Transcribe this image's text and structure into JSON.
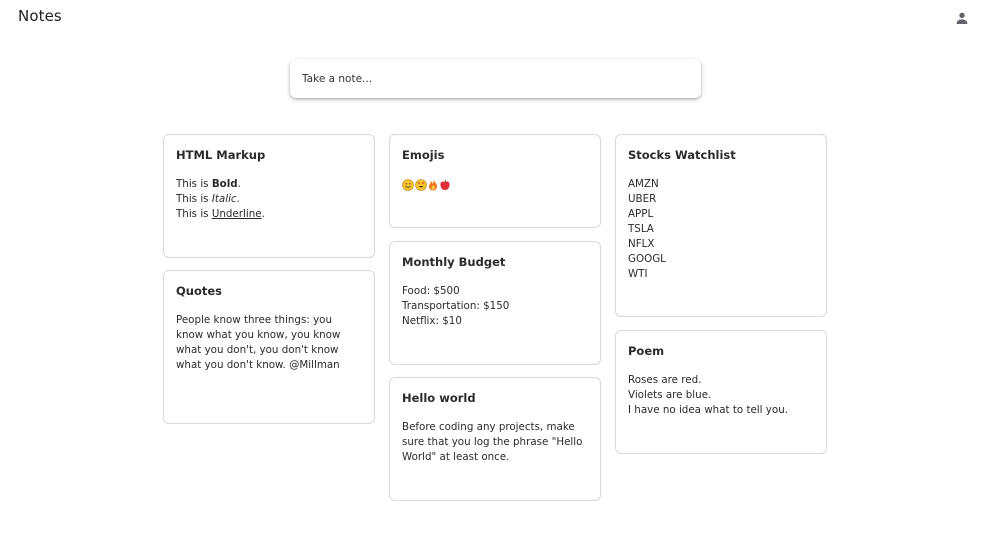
{
  "header": {
    "title": "Notes",
    "account_icon": "person-icon"
  },
  "composer": {
    "placeholder": "Take a note..."
  },
  "notes": {
    "html_markup": {
      "title": "HTML Markup",
      "line1": {
        "prefix": "This is ",
        "styled": "Bold",
        "suffix": "."
      },
      "line2": {
        "prefix": "This is ",
        "styled": "Italic",
        "suffix": "."
      },
      "line3": {
        "prefix": "This is ",
        "styled": "Underline",
        "suffix": "."
      }
    },
    "quotes": {
      "title": "Quotes",
      "body": "People know three things: you know what you know, you know what you don't, you don't know what you don't know. @Millman"
    },
    "emojis": {
      "title": "Emojis",
      "icons": [
        "smiling-face-icon",
        "heart-eyes-face-icon",
        "fire-icon",
        "apple-icon"
      ]
    },
    "monthly_budget": {
      "title": "Monthly Budget",
      "lines": [
        "Food: $500",
        "Transportation: $150",
        "Netflix: $10"
      ]
    },
    "hello_world": {
      "title": "Hello world",
      "body": "Before coding any projects, make sure that you log the phrase \"Hello World\" at least once."
    },
    "stocks": {
      "title": "Stocks Watchlist",
      "lines": [
        "AMZN",
        "UBER",
        "APPL",
        "TSLA",
        "NFLX",
        "GOOGL",
        "WTI"
      ]
    },
    "poem": {
      "title": "Poem",
      "lines": [
        "Roses are red.",
        "Violets are blue.",
        "I have no idea what to tell you."
      ]
    }
  },
  "colors": {
    "card_border": "#d9d9d9",
    "text": "#2b2b2b",
    "icon": "#5f6368"
  }
}
